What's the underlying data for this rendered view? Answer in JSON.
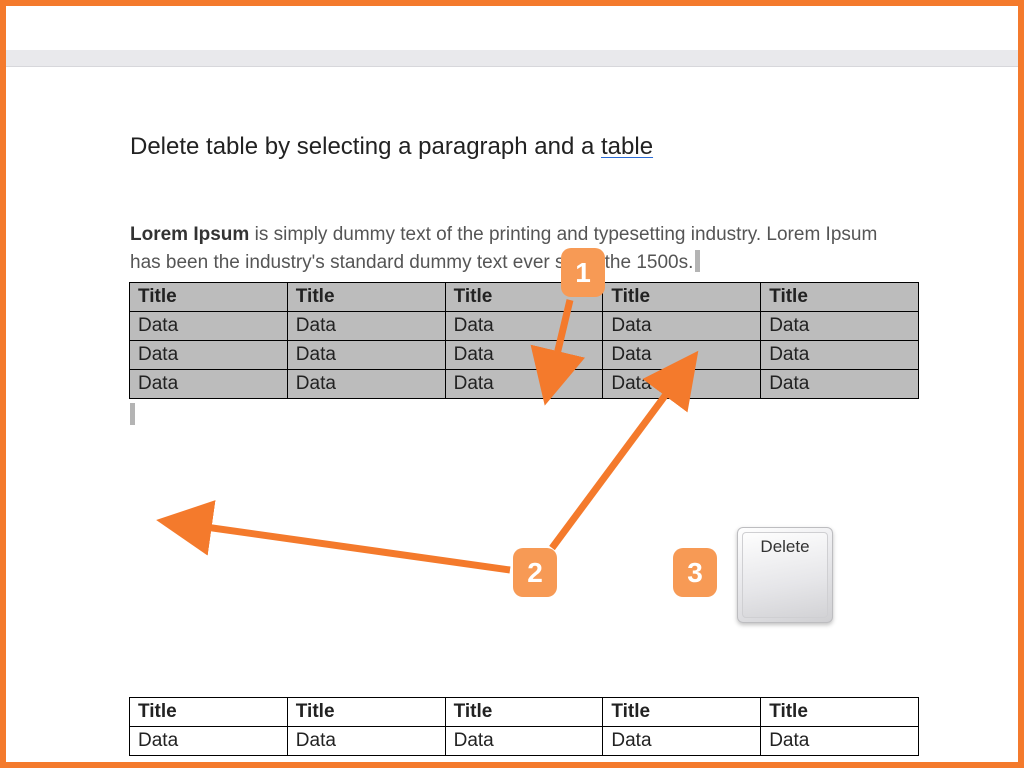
{
  "heading": {
    "prefix": "Delete table by selecting a paragraph and a ",
    "underlined": "table"
  },
  "paragraph": {
    "bold": "Lorem Ipsum",
    "rest1": " is simply dummy text of the printing and typesetting industry. Lorem Ipsum has been the industry's standard dummy text ever since the 1500s."
  },
  "table1": {
    "headers": [
      "Title",
      "Title",
      "Title",
      "Title",
      "Title"
    ],
    "rows": [
      [
        "Data",
        "Data",
        "Data",
        "Data",
        "Data"
      ],
      [
        "Data",
        "Data",
        "Data",
        "Data",
        "Data"
      ],
      [
        "Data",
        "Data",
        "Data",
        "Data",
        "Data"
      ]
    ]
  },
  "table2": {
    "headers": [
      "Title",
      "Title",
      "Title",
      "Title",
      "Title"
    ],
    "rows": [
      [
        "Data",
        "Data",
        "Data",
        "Data",
        "Data"
      ]
    ]
  },
  "annotations": {
    "step1": "1",
    "step2": "2",
    "step3": "3"
  },
  "key": {
    "label": "Delete"
  },
  "colors": {
    "accent": "#f47a2c",
    "badge": "#f79a55",
    "selection": "#bcbcbc"
  }
}
